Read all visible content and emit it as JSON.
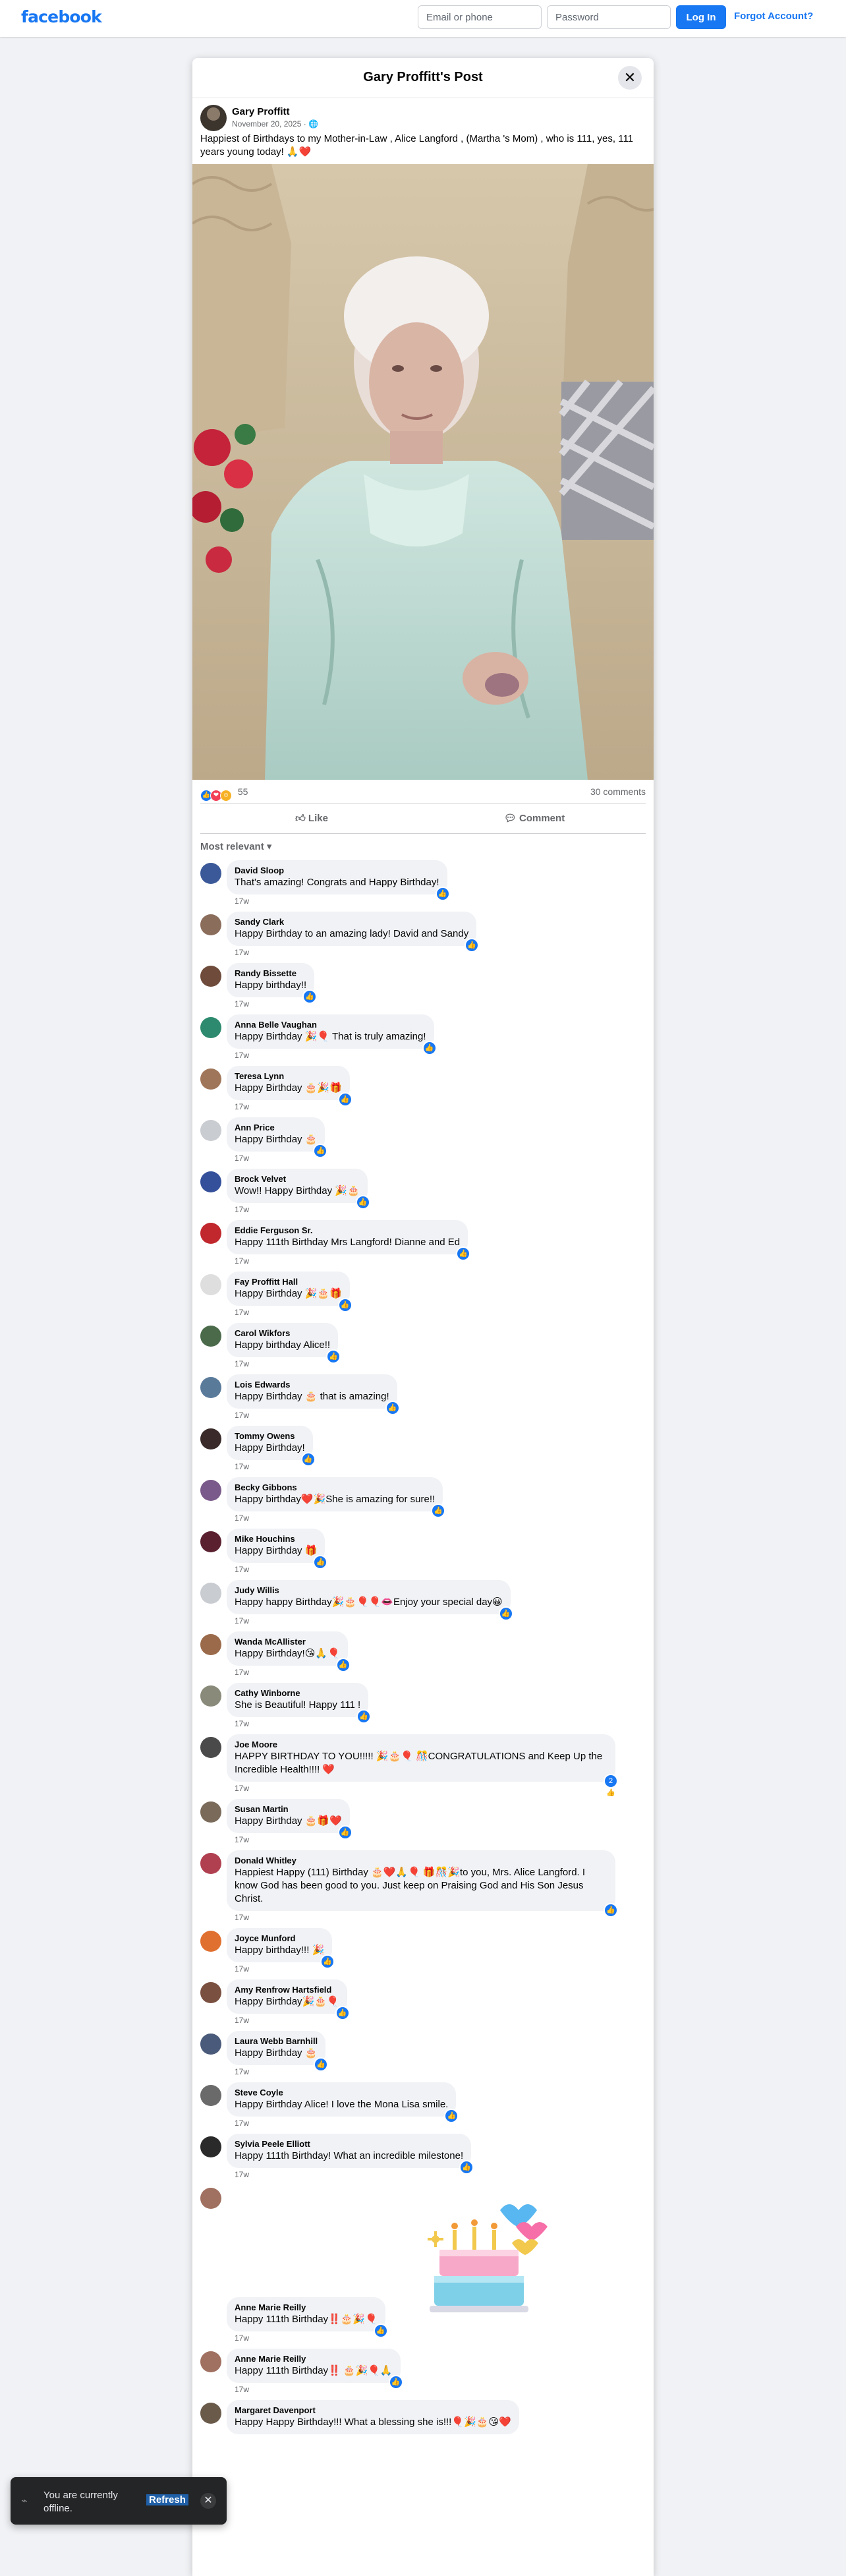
{
  "topbar": {
    "logo": "facebook",
    "email_placeholder": "Email or phone",
    "password_placeholder": "Password",
    "login_label": "Log In",
    "forgot_label": "Forgot Account?"
  },
  "dialog": {
    "title": "Gary Proffitt's Post",
    "close_icon": "close-icon"
  },
  "post": {
    "author": "Gary Proffitt",
    "date": "November 20, 2025 · 🌐",
    "text": "Happiest of Birthdays to my Mother-in-Law , Alice Langford , (Martha 's Mom) , who is 111, yes, 111 years young today! 🙏❤️",
    "reaction_count": "55",
    "comments_count": "30 comments",
    "like_label": "Like",
    "comment_label": "Comment",
    "sort_label": "Most relevant ▾"
  },
  "colors": {
    "brand": "#1877f2",
    "bubble": "#f0f2f5",
    "meta": "#65676b"
  },
  "comments": [
    {
      "name": "David Sloop",
      "text": "That's amazing! Congrats and Happy Birthday!",
      "time": "17w",
      "badge": "👍"
    },
    {
      "name": "Sandy Clark",
      "text": "Happy Birthday to an amazing lady! David and Sandy",
      "time": "17w",
      "badge": "👍"
    },
    {
      "name": "Randy Bissette",
      "text": "Happy birthday!!",
      "time": "17w",
      "badge": "👍"
    },
    {
      "name": "Anna Belle Vaughan",
      "text": "Happy Birthday 🎉🎈 That is truly amazing!",
      "time": "17w",
      "badge": "👍"
    },
    {
      "name": "Teresa Lynn",
      "text": "Happy Birthday 🎂🎉🎁",
      "time": "17w",
      "badge": "👍"
    },
    {
      "name": "Ann Price",
      "text": "Happy Birthday 🎂",
      "time": "17w",
      "badge": "👍"
    },
    {
      "name": "Brock Velvet",
      "text": "Wow!! Happy Birthday 🎉🎂",
      "time": "17w",
      "badge": "👍"
    },
    {
      "name": "Eddie Ferguson Sr.",
      "text": "Happy 111th Birthday Mrs Langford! Dianne and Ed",
      "time": "17w",
      "badge": "👍"
    },
    {
      "name": "Fay Proffitt Hall",
      "text": "Happy Birthday 🎉🎂🎁",
      "time": "17w",
      "badge": "👍"
    },
    {
      "name": "Carol Wikfors",
      "text": "Happy birthday Alice!!",
      "time": "17w",
      "badge": "👍"
    },
    {
      "name": "Lois Edwards",
      "text": "Happy Birthday 🎂 that is amazing!",
      "time": "17w",
      "badge": "👍"
    },
    {
      "name": "Tommy Owens",
      "text": "Happy Birthday!",
      "time": "17w",
      "badge": "👍"
    },
    {
      "name": "Becky Gibbons",
      "text": "Happy birthday❤️🎉She is amazing for sure!!",
      "time": "17w",
      "badge": "👍"
    },
    {
      "name": "Mike Houchins",
      "text": "Happy Birthday 🎁",
      "time": "17w",
      "badge": "👍"
    },
    {
      "name": "Judy Willis",
      "text": "Happy happy Birthday🎉🎂🎈🎈👄Enjoy your special day😀",
      "time": "17w",
      "badge": "👍"
    },
    {
      "name": "Wanda McAllister",
      "text": "Happy Birthday!😘🙏🎈",
      "time": "17w",
      "badge": "👍"
    },
    {
      "name": "Cathy Winborne",
      "text": "She is Beautiful! Happy 111 !",
      "time": "17w",
      "badge": "👍"
    },
    {
      "name": "Joe Moore",
      "text": "HAPPY BIRTHDAY TO YOU!!!!! 🎉🎂🎈 🎊CONGRATULATIONS and Keep Up the Incredible Health!!!! ❤️",
      "time": "17w",
      "badge": "2👍"
    },
    {
      "name": "Susan Martin",
      "text": "Happy Birthday 🎂🎁❤️",
      "time": "17w",
      "badge": "👍"
    },
    {
      "name": "Donald Whitley",
      "text": "Happiest Happy (111) Birthday 🎂❤️🙏🎈 🎁🎊🎉to you, Mrs. Alice Langford. I know God has been good to you. Just keep on Praising God and His Son Jesus Christ.",
      "time": "17w",
      "badge": "👍"
    },
    {
      "name": "Joyce Munford",
      "text": "Happy birthday!!! 🎉",
      "time": "17w",
      "badge": "👍"
    },
    {
      "name": "Amy Renfrow Hartsfield",
      "text": "Happy Birthday🎉🎂🎈",
      "time": "17w",
      "badge": "👍"
    },
    {
      "name": "Laura Webb Barnhill",
      "text": "Happy Birthday 🎂",
      "time": "17w",
      "badge": "👍"
    },
    {
      "name": "Steve Coyle",
      "text": "Happy Birthday Alice! I love the Mona Lisa smile.",
      "time": "17w",
      "badge": "👍"
    },
    {
      "name": "Sylvia Peele Elliott",
      "text": "Happy 111th Birthday! What an incredible milestone!",
      "time": "17w",
      "badge": "👍"
    },
    {
      "name": "Anne Marie Reilly",
      "text": "Happy 111th Birthday‼️🎂🎉🎈",
      "time": "17w",
      "badge": "👍",
      "sticker": "birthday-cake-sticker"
    },
    {
      "name": "Anne Marie Reilly",
      "text": "Happy 111th Birthday‼️ 🎂🎉🎈🙏",
      "time": "17w",
      "badge": "👍"
    },
    {
      "name": "Margaret Davenport",
      "text": "Happy Happy Birthday!!! What a blessing she is!!!🎈🎉🎂😘❤️",
      "time": "",
      "badge": ""
    }
  ],
  "toast": {
    "text": "You are currently offline.",
    "refresh_label": "Refresh",
    "close_icon": "close-icon",
    "wifi_icon": "wifi-off-icon"
  }
}
